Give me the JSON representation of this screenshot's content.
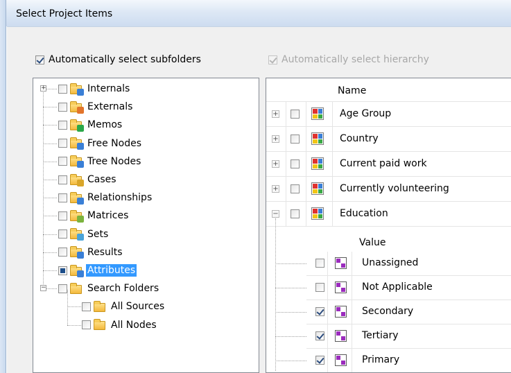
{
  "window": {
    "title": "Select Project Items"
  },
  "options": {
    "auto_subfolders": {
      "label": "Automatically select subfolders",
      "checked": true
    },
    "auto_hierarchy": {
      "label": "Automatically select hierarchy",
      "checked": true,
      "enabled": false
    }
  },
  "tree": {
    "items": [
      {
        "label": "Internals",
        "icon": "internals-folder-icon",
        "expandable": true
      },
      {
        "label": "Externals",
        "icon": "externals-folder-icon"
      },
      {
        "label": "Memos",
        "icon": "memos-folder-icon"
      },
      {
        "label": "Free Nodes",
        "icon": "free-nodes-folder-icon"
      },
      {
        "label": "Tree Nodes",
        "icon": "tree-nodes-folder-icon"
      },
      {
        "label": "Cases",
        "icon": "cases-folder-icon"
      },
      {
        "label": "Relationships",
        "icon": "relationships-folder-icon"
      },
      {
        "label": "Matrices",
        "icon": "matrices-folder-icon"
      },
      {
        "label": "Sets",
        "icon": "sets-folder-icon"
      },
      {
        "label": "Results",
        "icon": "results-folder-icon"
      },
      {
        "label": "Attributes",
        "icon": "attributes-folder-icon",
        "selected": true,
        "partial": true
      },
      {
        "label": "Search Folders",
        "icon": "search-folders-icon",
        "expandable": true,
        "expanded": true
      },
      {
        "label": "All Sources",
        "icon": "all-sources-folder-icon",
        "child": true
      },
      {
        "label": "All Nodes",
        "icon": "all-nodes-folder-icon",
        "child": true
      }
    ]
  },
  "grid": {
    "column_name": "Name",
    "rows": [
      {
        "label": "Age Group",
        "expanded": false
      },
      {
        "label": "Country",
        "expanded": false
      },
      {
        "label": "Current paid work",
        "expanded": false
      },
      {
        "label": "Currently volunteering",
        "expanded": false
      },
      {
        "label": "Education",
        "expanded": true
      }
    ],
    "sub_column_value": "Value",
    "values": [
      {
        "label": "Unassigned",
        "checked": false
      },
      {
        "label": "Not Applicable",
        "checked": false
      },
      {
        "label": "Secondary",
        "checked": true
      },
      {
        "label": "Tertiary",
        "checked": true
      },
      {
        "label": "Primary",
        "checked": true
      }
    ]
  },
  "colors": {
    "selection": "#3399ff",
    "attribute_icon": [
      "#e0322f",
      "#3a7fd6",
      "#f2c515",
      "#3aa845"
    ],
    "value_icon": [
      "#9b2bbd",
      "#ffffff",
      "#ffffff",
      "#9b2bbd"
    ]
  }
}
